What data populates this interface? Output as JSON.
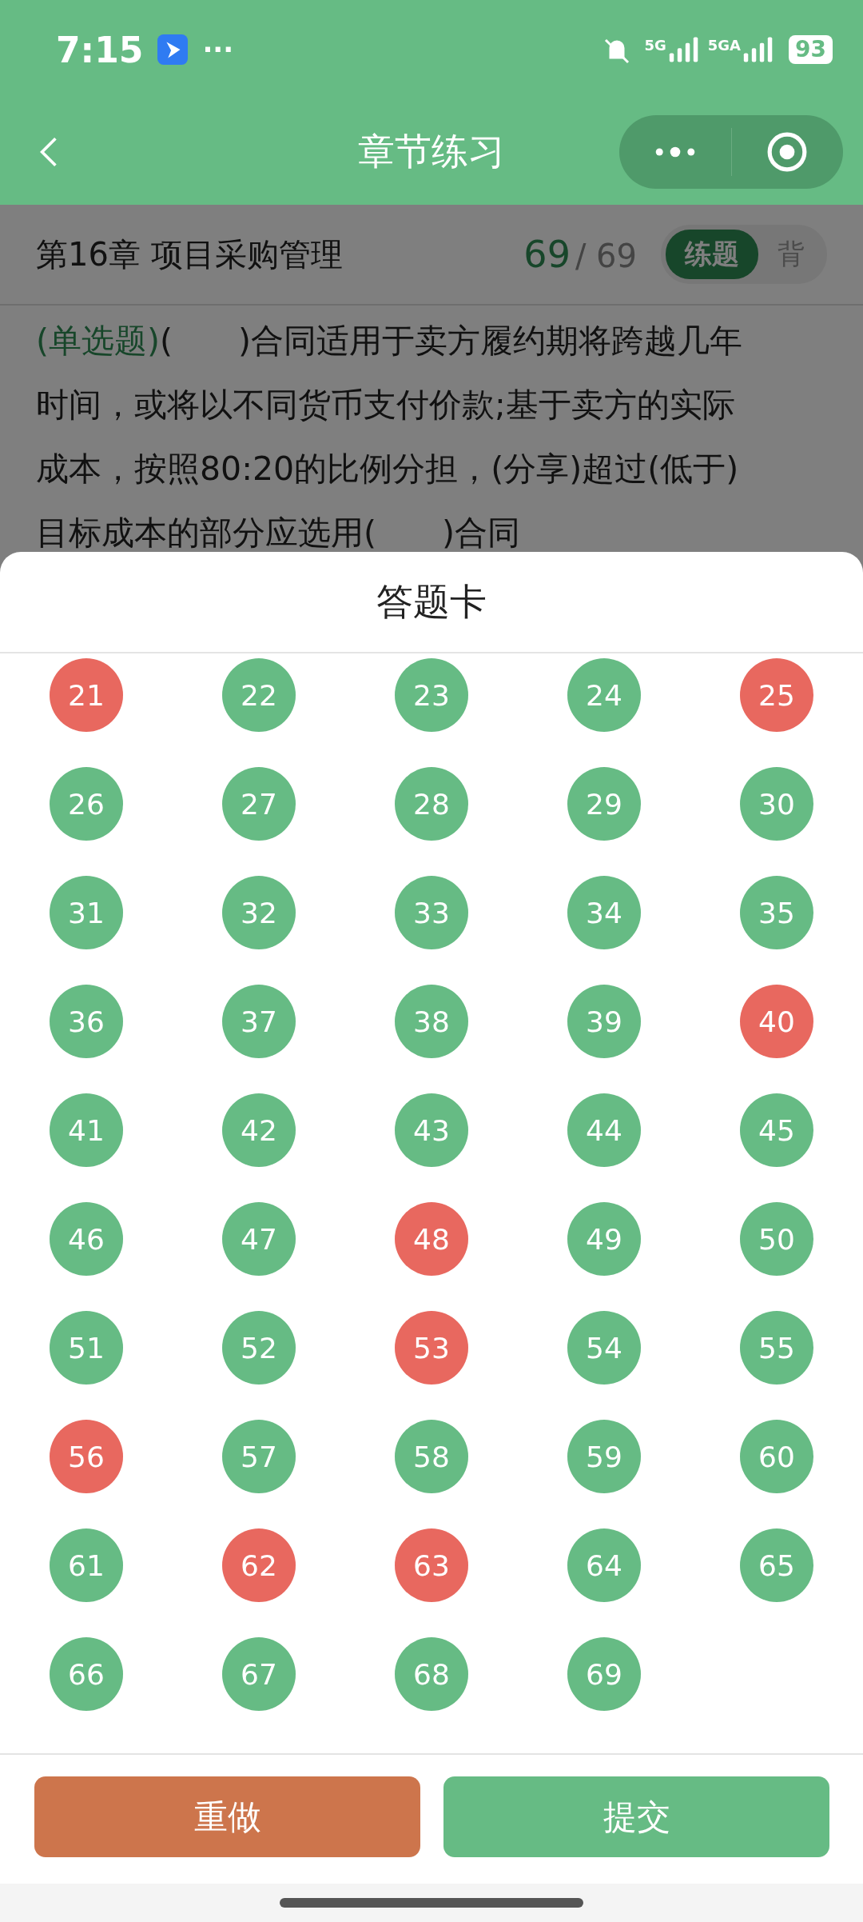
{
  "status_bar": {
    "time": "7:15",
    "dots": "···",
    "battery": "93",
    "net1": "5G",
    "net2": "5GA"
  },
  "nav": {
    "title": "章节练习"
  },
  "chapter": {
    "title": "第16章 项目采购管理",
    "current": "69",
    "total": "/ 69",
    "modes": [
      {
        "label": "练题",
        "selected": true
      },
      {
        "label": "背",
        "selected": false
      }
    ]
  },
  "question": {
    "type": "(单选题)",
    "lines": [
      "(　　)合同适用于卖方履约期将跨越几年",
      "时间，或将以不同货币支付价款;基于卖方的实际",
      "成本，按照80:20的比例分担，(分享)超过(低于)",
      "目标成本的部分应选用(　　)合同"
    ]
  },
  "answer_card": {
    "title": "答题卡",
    "items": [
      {
        "label": "21",
        "color": "#e8685f"
      },
      {
        "label": "22",
        "color": "#66bb84"
      },
      {
        "label": "23",
        "color": "#66bb84"
      },
      {
        "label": "24",
        "color": "#66bb84"
      },
      {
        "label": "25",
        "color": "#e8685f"
      },
      {
        "label": "26",
        "color": "#66bb84"
      },
      {
        "label": "27",
        "color": "#66bb84"
      },
      {
        "label": "28",
        "color": "#66bb84"
      },
      {
        "label": "29",
        "color": "#66bb84"
      },
      {
        "label": "30",
        "color": "#66bb84"
      },
      {
        "label": "31",
        "color": "#66bb84"
      },
      {
        "label": "32",
        "color": "#66bb84"
      },
      {
        "label": "33",
        "color": "#66bb84"
      },
      {
        "label": "34",
        "color": "#66bb84"
      },
      {
        "label": "35",
        "color": "#66bb84"
      },
      {
        "label": "36",
        "color": "#66bb84"
      },
      {
        "label": "37",
        "color": "#66bb84"
      },
      {
        "label": "38",
        "color": "#66bb84"
      },
      {
        "label": "39",
        "color": "#66bb84"
      },
      {
        "label": "40",
        "color": "#e8685f"
      },
      {
        "label": "41",
        "color": "#66bb84"
      },
      {
        "label": "42",
        "color": "#66bb84"
      },
      {
        "label": "43",
        "color": "#66bb84"
      },
      {
        "label": "44",
        "color": "#66bb84"
      },
      {
        "label": "45",
        "color": "#66bb84"
      },
      {
        "label": "46",
        "color": "#66bb84"
      },
      {
        "label": "47",
        "color": "#66bb84"
      },
      {
        "label": "48",
        "color": "#e8685f"
      },
      {
        "label": "49",
        "color": "#66bb84"
      },
      {
        "label": "50",
        "color": "#66bb84"
      },
      {
        "label": "51",
        "color": "#66bb84"
      },
      {
        "label": "52",
        "color": "#66bb84"
      },
      {
        "label": "53",
        "color": "#e8685f"
      },
      {
        "label": "54",
        "color": "#66bb84"
      },
      {
        "label": "55",
        "color": "#66bb84"
      },
      {
        "label": "56",
        "color": "#e8685f"
      },
      {
        "label": "57",
        "color": "#66bb84"
      },
      {
        "label": "58",
        "color": "#66bb84"
      },
      {
        "label": "59",
        "color": "#66bb84"
      },
      {
        "label": "60",
        "color": "#66bb84"
      },
      {
        "label": "61",
        "color": "#66bb84"
      },
      {
        "label": "62",
        "color": "#e8685f"
      },
      {
        "label": "63",
        "color": "#e8685f"
      },
      {
        "label": "64",
        "color": "#66bb84"
      },
      {
        "label": "65",
        "color": "#66bb84"
      },
      {
        "label": "66",
        "color": "#66bb84"
      },
      {
        "label": "67",
        "color": "#66bb84"
      },
      {
        "label": "68",
        "color": "#66bb84"
      },
      {
        "label": "69",
        "color": "#66bb84"
      }
    ],
    "buttons": [
      {
        "label": "重做",
        "kind": "redo"
      },
      {
        "label": "提交",
        "kind": "submit"
      }
    ]
  }
}
